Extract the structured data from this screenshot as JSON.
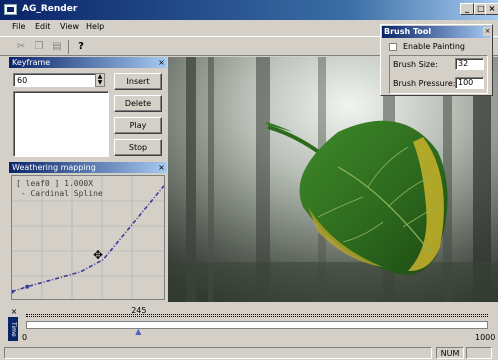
{
  "window": {
    "title": "AG_Render",
    "buttons": [
      "_",
      "□",
      "×"
    ]
  },
  "menu": [
    "File",
    "Edit",
    "View",
    "Help"
  ],
  "toolbar": {
    "icons": [
      "cut-icon",
      "copy-icon",
      "paste-icon",
      "help-icon"
    ]
  },
  "keyframe": {
    "title": "Keyframe",
    "value": "60",
    "buttons": [
      "Insert",
      "Delete",
      "Play",
      "Stop"
    ]
  },
  "weathering": {
    "title": "Weathering mapping",
    "legend_line1": "[ leaf0 ] 1.000X",
    "legend_line2": " - Cardinal Spline",
    "curve": [
      [
        0.0,
        0.06
      ],
      [
        0.1,
        0.1
      ],
      [
        0.45,
        0.22
      ],
      [
        0.6,
        0.32
      ],
      [
        1.0,
        0.92
      ]
    ]
  },
  "brush": {
    "title": "Brush Tool",
    "enable_label": "Enable Painting",
    "size_label": "Brush Size:",
    "size_value": "32",
    "pressure_label": "Brush Pressure:",
    "pressure_value": "100"
  },
  "timeline": {
    "label": "Time",
    "start": "0",
    "end": "1000",
    "current": "245",
    "current_value": 245,
    "max_value": 1000
  },
  "status": {
    "num": "NUM"
  },
  "colors": {
    "titlebar": "#0a246a",
    "curve": "#3a3aa0",
    "leaf_green": "#2d6a1e",
    "leaf_yellow": "#c8b32a"
  }
}
